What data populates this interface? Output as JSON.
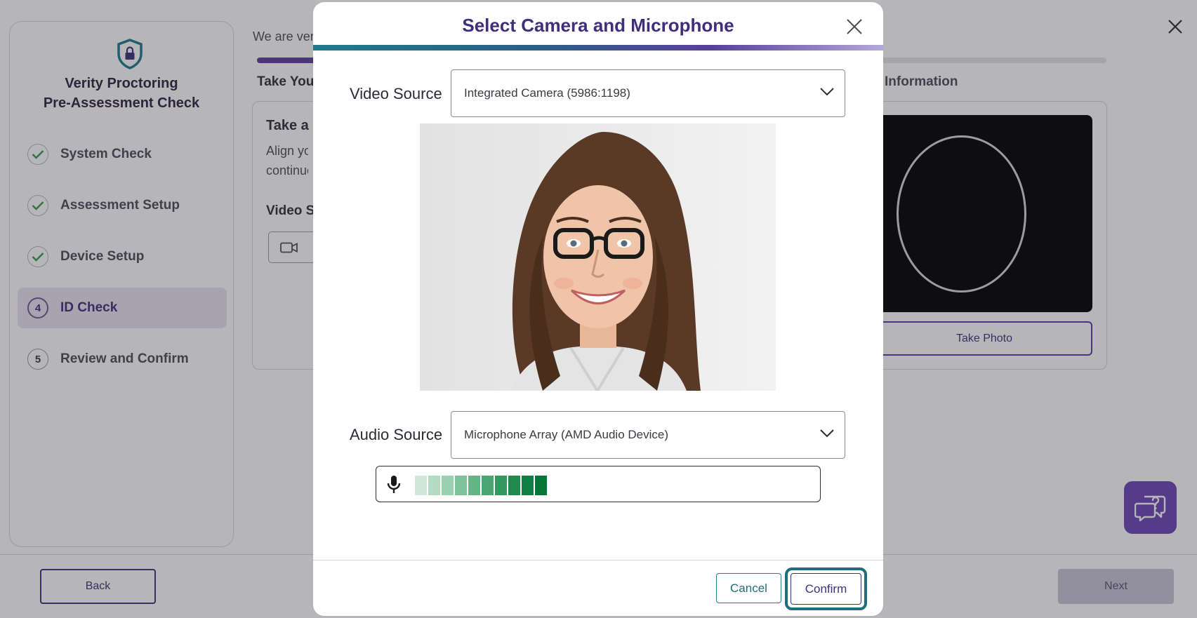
{
  "sidebar": {
    "title_line1": "Verity Proctoring",
    "title_line2": "Pre-Assessment Check",
    "steps": [
      {
        "badge": "",
        "label": "System Check"
      },
      {
        "badge": "",
        "label": "Assessment Setup"
      },
      {
        "badge": "",
        "label": "Device Setup"
      },
      {
        "badge": "4",
        "label": "ID Check"
      },
      {
        "badge": "5",
        "label": "Review and Confirm"
      }
    ]
  },
  "main": {
    "intro": "We are ver",
    "tab_left": "Take You",
    "tab_right": "Information",
    "card_title": "Take a",
    "card_desc_line1": "Align yo",
    "card_desc_line2": "continue",
    "video_label": "Video S",
    "take_photo": "Take Photo"
  },
  "footer": {
    "back": "Back",
    "next": "Next"
  },
  "modal": {
    "title": "Select Camera and Microphone",
    "video_source_label": "Video Source",
    "video_source_value": "Integrated Camera (5986:1198)",
    "audio_source_label": "Audio Source",
    "audio_source_value": "Microphone Array (AMD Audio Device)",
    "audio_level_segments": 10,
    "cancel": "Cancel",
    "confirm": "Confirm"
  },
  "colors": {
    "brand_purple": "#3f2f7a",
    "accent_teal": "#1e6e7e",
    "help_button": "#6c45b8",
    "meter_greens": [
      "#cfe8d9",
      "#b3dcc4",
      "#99d0b0",
      "#7fc39b",
      "#63b585",
      "#4aa771",
      "#32985e",
      "#1f8b4e",
      "#117f43",
      "#037638"
    ]
  }
}
